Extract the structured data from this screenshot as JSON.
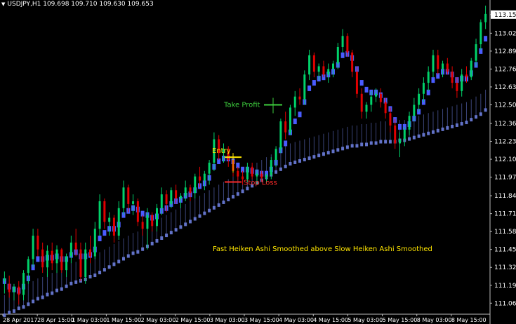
{
  "header": {
    "symbol_info": "USDJPY,H1  109.698 109.710 109.630 109.653"
  },
  "colors": {
    "bull": "#00d26a",
    "bear": "#e00000",
    "fast_ha": "#4a5cff",
    "slow_ha": "#6272c8",
    "price_label_bg": "#ffffff",
    "text": "#ffffff",
    "annotation_yellow": "#ffe600",
    "annotation_green": "#3ecf3e",
    "annotation_red": "#ff2a2a"
  },
  "chart_data": {
    "type": "candlestick",
    "title": "",
    "xlabel": "",
    "ylabel": "",
    "ylim": [
      110.98,
      113.2
    ],
    "y_ticks": [
      "113.155",
      "113.020",
      "112.890",
      "112.760",
      "112.630",
      "112.500",
      "112.365",
      "112.235",
      "112.105",
      "111.975",
      "111.840",
      "111.710",
      "111.580",
      "111.450",
      "111.320",
      "111.190",
      "111.060"
    ],
    "x_ticks": [
      "28 Apr 2017",
      "28 Apr 15:00",
      "1 May 03:00",
      "1 May 15:00",
      "2 May 03:00",
      "2 May 15:00",
      "3 May 03:00",
      "3 May 15:00",
      "4 May 03:00",
      "4 May 15:00",
      "5 May 03:00",
      "5 May 15:00",
      "8 May 03:00",
      "8 May 15:00"
    ],
    "current_price": "113.155",
    "annotations": {
      "entry": "Entry",
      "take_profit": "Take Profit",
      "stop_loss": "Stop Loss",
      "caption": "Fast Heiken Ashi Smoothed above Slow Heiken Ashi Smoothed"
    },
    "trade_levels": {
      "entry": 112.12,
      "take_profit": 112.5,
      "stop_loss": 111.94
    },
    "series": [
      {
        "name": "Price",
        "values": [
          [
            111.22,
            111.29,
            111.13,
            111.24
          ],
          [
            111.2,
            111.26,
            111.1,
            111.14
          ],
          [
            111.14,
            111.2,
            111.08,
            111.18
          ],
          [
            111.18,
            111.22,
            111.05,
            111.12
          ],
          [
            111.12,
            111.3,
            111.08,
            111.28
          ],
          [
            111.28,
            111.4,
            111.2,
            111.38
          ],
          [
            111.38,
            111.6,
            111.32,
            111.55
          ],
          [
            111.55,
            111.6,
            111.4,
            111.45
          ],
          [
            111.45,
            111.5,
            111.28,
            111.32
          ],
          [
            111.32,
            111.48,
            111.25,
            111.44
          ],
          [
            111.44,
            111.5,
            111.3,
            111.35
          ],
          [
            111.35,
            111.48,
            111.28,
            111.45
          ],
          [
            111.45,
            111.46,
            111.28,
            111.3
          ],
          [
            111.3,
            111.42,
            111.25,
            111.4
          ],
          [
            111.4,
            111.55,
            111.35,
            111.5
          ],
          [
            111.5,
            111.6,
            111.4,
            111.45
          ],
          [
            111.45,
            111.5,
            111.22,
            111.25
          ],
          [
            111.25,
            111.5,
            111.2,
            111.45
          ],
          [
            111.45,
            111.55,
            111.35,
            111.4
          ],
          [
            111.4,
            111.65,
            111.38,
            111.6
          ],
          [
            111.6,
            111.85,
            111.55,
            111.8
          ],
          [
            111.8,
            111.82,
            111.6,
            111.65
          ],
          [
            111.65,
            111.72,
            111.55,
            111.68
          ],
          [
            111.68,
            111.7,
            111.5,
            111.55
          ],
          [
            111.55,
            111.8,
            111.52,
            111.75
          ],
          [
            111.75,
            111.95,
            111.7,
            111.9
          ],
          [
            111.9,
            111.92,
            111.72,
            111.78
          ],
          [
            111.78,
            111.85,
            111.7,
            111.8
          ],
          [
            111.8,
            111.82,
            111.62,
            111.65
          ],
          [
            111.65,
            111.7,
            111.55,
            111.6
          ],
          [
            111.6,
            111.75,
            111.45,
            111.7
          ],
          [
            111.7,
            111.72,
            111.58,
            111.62
          ],
          [
            111.62,
            111.78,
            111.58,
            111.75
          ],
          [
            111.75,
            111.9,
            111.7,
            111.85
          ],
          [
            111.85,
            111.88,
            111.72,
            111.78
          ],
          [
            111.78,
            111.9,
            111.75,
            111.88
          ],
          [
            111.88,
            111.92,
            111.78,
            111.82
          ],
          [
            111.82,
            111.86,
            111.75,
            111.84
          ],
          [
            111.84,
            111.95,
            111.8,
            111.9
          ],
          [
            111.9,
            111.92,
            111.8,
            111.86
          ],
          [
            111.86,
            112.0,
            111.82,
            111.98
          ],
          [
            111.98,
            112.05,
            111.9,
            111.95
          ],
          [
            111.95,
            112.02,
            111.88,
            112.0
          ],
          [
            112.0,
            112.1,
            111.92,
            112.08
          ],
          [
            112.08,
            112.3,
            112.02,
            112.25
          ],
          [
            112.25,
            112.28,
            112.1,
            112.15
          ],
          [
            112.15,
            112.22,
            112.08,
            112.18
          ],
          [
            112.18,
            112.2,
            112.05,
            112.1
          ],
          [
            112.1,
            112.12,
            111.98,
            112.02
          ],
          [
            112.02,
            112.05,
            111.95,
            111.98
          ],
          [
            111.98,
            112.02,
            111.92,
            111.96
          ],
          [
            111.96,
            112.08,
            111.94,
            112.05
          ],
          [
            112.05,
            112.08,
            111.96,
            111.98
          ],
          [
            111.98,
            112.03,
            111.92,
            112.0
          ],
          [
            112.0,
            112.02,
            111.94,
            111.97
          ],
          [
            111.97,
            112.0,
            111.93,
            111.99
          ],
          [
            111.99,
            112.12,
            111.96,
            112.1
          ],
          [
            112.1,
            112.2,
            112.05,
            112.18
          ],
          [
            112.18,
            112.4,
            112.15,
            112.38
          ],
          [
            112.38,
            112.45,
            112.25,
            112.3
          ],
          [
            112.3,
            112.5,
            112.28,
            112.48
          ],
          [
            112.48,
            112.6,
            112.42,
            112.56
          ],
          [
            112.56,
            112.62,
            112.5,
            112.54
          ],
          [
            112.54,
            112.75,
            112.5,
            112.72
          ],
          [
            112.72,
            112.9,
            112.68,
            112.86
          ],
          [
            112.86,
            112.88,
            112.7,
            112.74
          ],
          [
            112.74,
            112.8,
            112.68,
            112.78
          ],
          [
            112.78,
            112.82,
            112.7,
            112.72
          ],
          [
            112.72,
            112.8,
            112.66,
            112.76
          ],
          [
            112.76,
            112.82,
            112.7,
            112.8
          ],
          [
            112.8,
            112.95,
            112.76,
            112.92
          ],
          [
            112.92,
            113.05,
            112.88,
            113.0
          ],
          [
            113.0,
            113.02,
            112.85,
            112.88
          ],
          [
            112.88,
            112.9,
            112.7,
            112.74
          ],
          [
            112.74,
            112.78,
            112.55,
            112.58
          ],
          [
            112.58,
            112.62,
            112.4,
            112.45
          ],
          [
            112.45,
            112.52,
            112.4,
            112.5
          ],
          [
            112.5,
            112.6,
            112.45,
            112.56
          ],
          [
            112.56,
            112.62,
            112.52,
            112.58
          ],
          [
            112.58,
            112.62,
            112.48,
            112.52
          ],
          [
            112.52,
            112.55,
            112.4,
            112.44
          ],
          [
            112.44,
            112.48,
            112.3,
            112.35
          ],
          [
            112.35,
            112.4,
            112.18,
            112.22
          ],
          [
            112.22,
            112.3,
            112.12,
            112.25
          ],
          [
            112.25,
            112.34,
            112.2,
            112.32
          ],
          [
            112.32,
            112.45,
            112.28,
            112.42
          ],
          [
            112.42,
            112.55,
            112.38,
            112.5
          ],
          [
            112.5,
            112.62,
            112.45,
            112.58
          ],
          [
            112.58,
            112.7,
            112.52,
            112.66
          ],
          [
            112.66,
            112.78,
            112.6,
            112.74
          ],
          [
            112.74,
            112.9,
            112.7,
            112.86
          ],
          [
            112.86,
            112.9,
            112.72,
            112.76
          ],
          [
            112.76,
            112.82,
            112.7,
            112.8
          ],
          [
            112.8,
            112.84,
            112.72,
            112.74
          ],
          [
            112.74,
            112.78,
            112.62,
            112.66
          ],
          [
            112.66,
            112.7,
            112.55,
            112.6
          ],
          [
            112.6,
            112.76,
            112.56,
            112.72
          ],
          [
            112.72,
            112.78,
            112.66,
            112.7
          ],
          [
            112.7,
            112.84,
            112.68,
            112.82
          ],
          [
            112.82,
            112.98,
            112.78,
            112.94
          ],
          [
            112.94,
            113.12,
            112.9,
            113.1
          ],
          [
            113.1,
            113.22,
            113.05,
            113.16
          ]
        ]
      },
      {
        "name": "Fast HA",
        "values": [
          111.22,
          111.18,
          111.16,
          111.15,
          111.18,
          111.24,
          111.32,
          111.38,
          111.38,
          111.39,
          111.39,
          111.4,
          111.38,
          111.38,
          111.41,
          111.43,
          111.4,
          111.4,
          111.41,
          111.45,
          111.53,
          111.57,
          111.6,
          111.6,
          111.63,
          111.7,
          111.73,
          111.75,
          111.74,
          111.71,
          111.7,
          111.68,
          111.69,
          111.73,
          111.75,
          111.78,
          111.8,
          111.81,
          111.84,
          111.85,
          111.88,
          111.91,
          111.93,
          111.97,
          112.05,
          112.09,
          112.11,
          112.11,
          112.09,
          112.06,
          112.03,
          112.03,
          112.02,
          112.01,
          112.0,
          112.0,
          112.03,
          112.08,
          112.17,
          112.22,
          112.3,
          112.38,
          112.43,
          112.52,
          112.62,
          112.66,
          112.69,
          112.7,
          112.72,
          112.74,
          112.79,
          112.86,
          112.87,
          112.84,
          112.76,
          112.66,
          112.61,
          112.59,
          112.59,
          112.57,
          112.53,
          112.47,
          112.39,
          112.34,
          112.34,
          112.36,
          112.4,
          112.45,
          112.52,
          112.59,
          112.68,
          112.71,
          112.74,
          112.74,
          112.72,
          112.68,
          112.69,
          112.69,
          112.73,
          112.79,
          112.89,
          112.98
        ]
      },
      {
        "name": "Slow HA",
        "values": [
          110.98,
          111.0,
          111.01,
          111.03,
          111.04,
          111.06,
          111.08,
          111.1,
          111.11,
          111.13,
          111.14,
          111.16,
          111.17,
          111.19,
          111.21,
          111.22,
          111.23,
          111.24,
          111.26,
          111.27,
          111.29,
          111.31,
          111.33,
          111.35,
          111.37,
          111.39,
          111.41,
          111.43,
          111.44,
          111.46,
          111.48,
          111.5,
          111.52,
          111.54,
          111.56,
          111.58,
          111.6,
          111.62,
          111.64,
          111.66,
          111.68,
          111.7,
          111.72,
          111.74,
          111.76,
          111.78,
          111.8,
          111.82,
          111.84,
          111.86,
          111.88,
          111.9,
          111.92,
          111.94,
          111.96,
          111.98,
          112.0,
          112.02,
          112.04,
          112.06,
          112.08,
          112.09,
          112.1,
          112.11,
          112.12,
          112.13,
          112.14,
          112.15,
          112.16,
          112.17,
          112.18,
          112.19,
          112.2,
          112.21,
          112.21,
          112.22,
          112.22,
          112.23,
          112.23,
          112.24,
          112.24,
          112.24,
          112.24,
          112.25,
          112.25,
          112.26,
          112.27,
          112.28,
          112.29,
          112.3,
          112.31,
          112.32,
          112.33,
          112.34,
          112.35,
          112.36,
          112.37,
          112.38,
          112.4,
          112.42,
          112.44,
          112.47
        ]
      }
    ]
  }
}
